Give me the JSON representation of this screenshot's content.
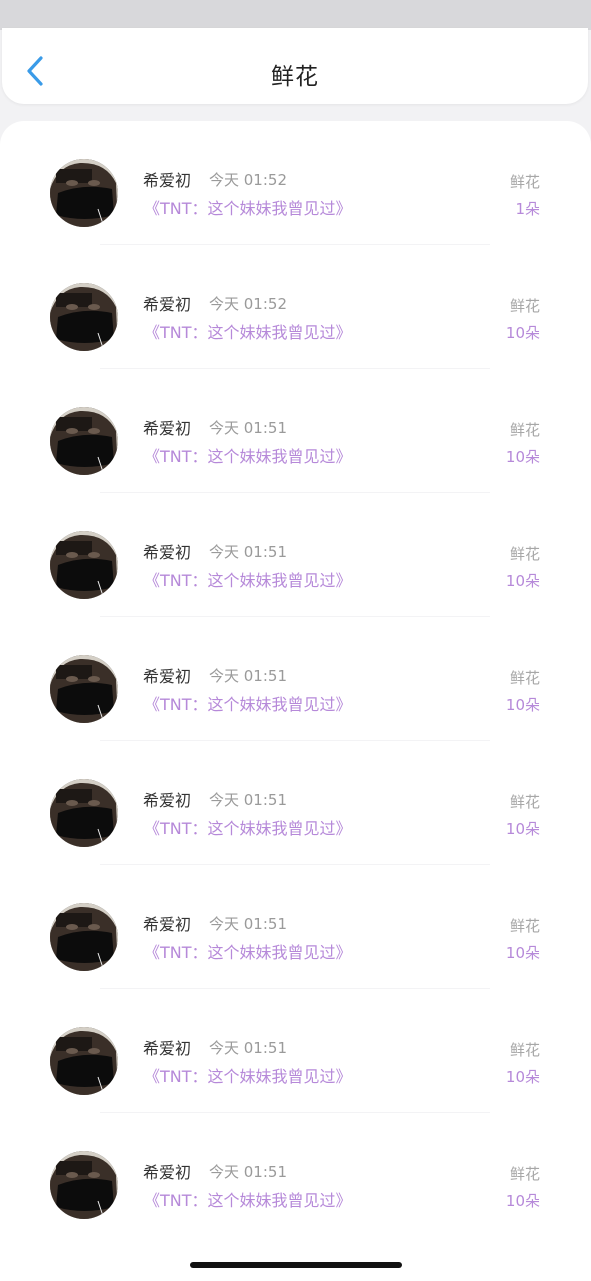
{
  "header": {
    "title": "鲜花",
    "back_icon": "chevron-left-icon",
    "accent_color": "#3a9be8"
  },
  "colors": {
    "link": "#b689d9",
    "muted": "#9a9a9a",
    "name": "#333333"
  },
  "records": [
    {
      "name": "希爱初",
      "time": "今天 01:52",
      "link": "《TNT：这个妹妹我曾见过》",
      "label": "鲜花",
      "count": "1朵"
    },
    {
      "name": "希爱初",
      "time": "今天 01:52",
      "link": "《TNT：这个妹妹我曾见过》",
      "label": "鲜花",
      "count": "10朵"
    },
    {
      "name": "希爱初",
      "time": "今天 01:51",
      "link": "《TNT：这个妹妹我曾见过》",
      "label": "鲜花",
      "count": "10朵"
    },
    {
      "name": "希爱初",
      "time": "今天 01:51",
      "link": "《TNT：这个妹妹我曾见过》",
      "label": "鲜花",
      "count": "10朵"
    },
    {
      "name": "希爱初",
      "time": "今天 01:51",
      "link": "《TNT：这个妹妹我曾见过》",
      "label": "鲜花",
      "count": "10朵"
    },
    {
      "name": "希爱初",
      "time": "今天 01:51",
      "link": "《TNT：这个妹妹我曾见过》",
      "label": "鲜花",
      "count": "10朵"
    },
    {
      "name": "希爱初",
      "time": "今天 01:51",
      "link": "《TNT：这个妹妹我曾见过》",
      "label": "鲜花",
      "count": "10朵"
    },
    {
      "name": "希爱初",
      "time": "今天 01:51",
      "link": "《TNT：这个妹妹我曾见过》",
      "label": "鲜花",
      "count": "10朵"
    },
    {
      "name": "希爱初",
      "time": "今天 01:51",
      "link": "《TNT：这个妹妹我曾见过》",
      "label": "鲜花",
      "count": "10朵"
    }
  ]
}
